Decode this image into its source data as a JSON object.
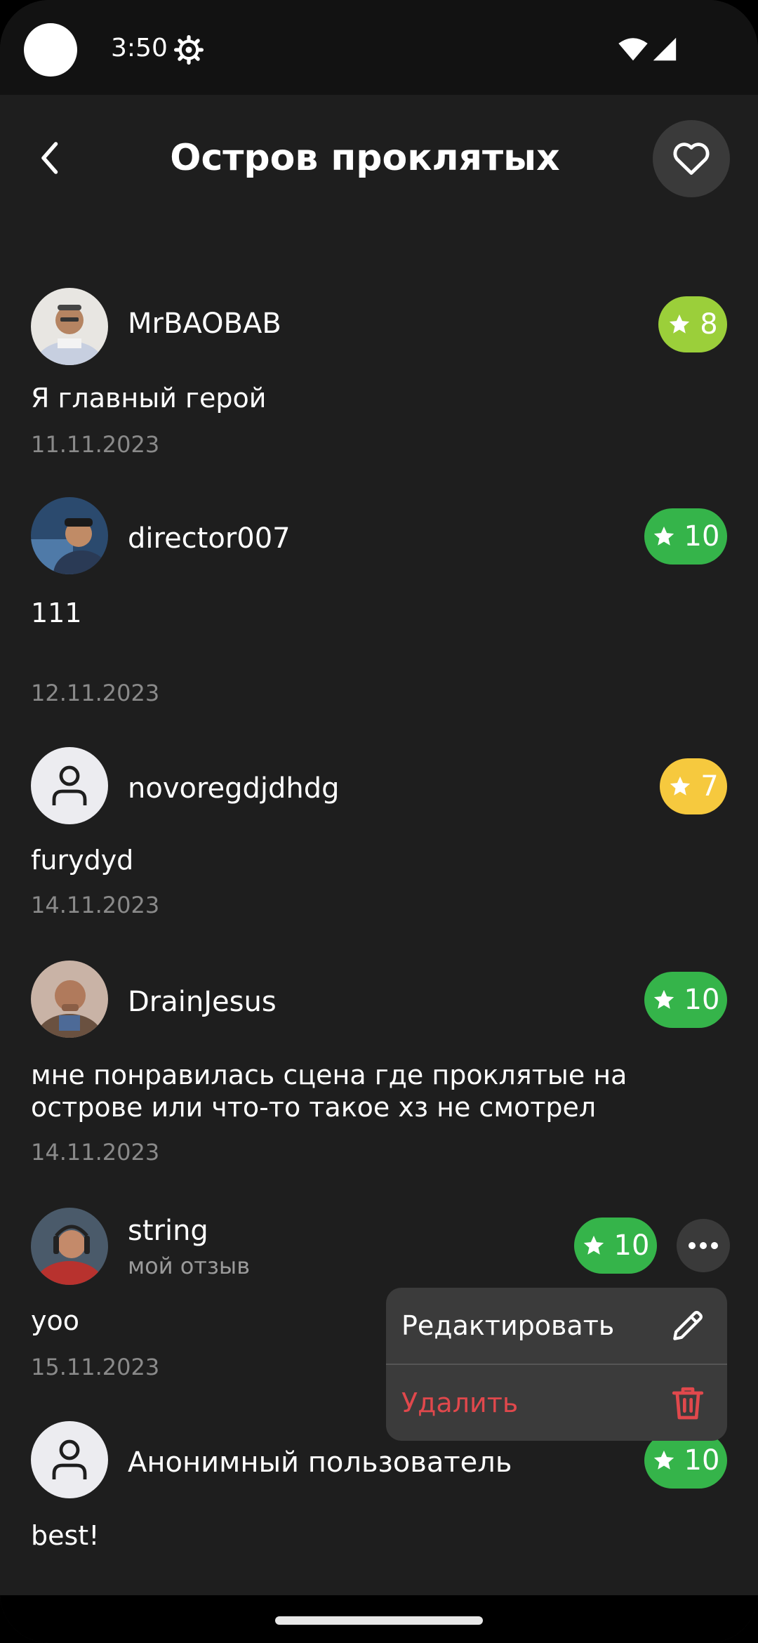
{
  "status_bar": {
    "time": "3:50"
  },
  "header": {
    "title": "Остров проклятых",
    "back_icon": "chevron-left-icon",
    "favorite_icon": "heart-icon"
  },
  "colors": {
    "rating_lime": "#9bcf3a",
    "rating_green": "#35b44a",
    "rating_yellow": "#f6c93e",
    "delete_red": "#e0484c"
  },
  "reviews": [
    {
      "author": "MrBAOBAB",
      "rating": "8",
      "text": "Я главный герой",
      "date": "11.11.2023"
    },
    {
      "author": "director007",
      "rating": "10",
      "text": "111",
      "date": "12.11.2023"
    },
    {
      "author": "novoregdjdhdg",
      "rating": "7",
      "text": "furydyd",
      "date": "14.11.2023"
    },
    {
      "author": "DrainJesus",
      "rating": "10",
      "text": "мне понравилась сцена где проклятые на острове или что-то такое хз не смотрел",
      "date": "14.11.2023"
    },
    {
      "author": "string",
      "subtitle": "мой отзыв",
      "rating": "10",
      "text": "yoo",
      "date": "15.11.2023"
    },
    {
      "author": "Анонимный пользователь",
      "rating": "10",
      "text": "best!"
    }
  ],
  "context_menu": {
    "edit_label": "Редактировать",
    "delete_label": "Удалить"
  }
}
